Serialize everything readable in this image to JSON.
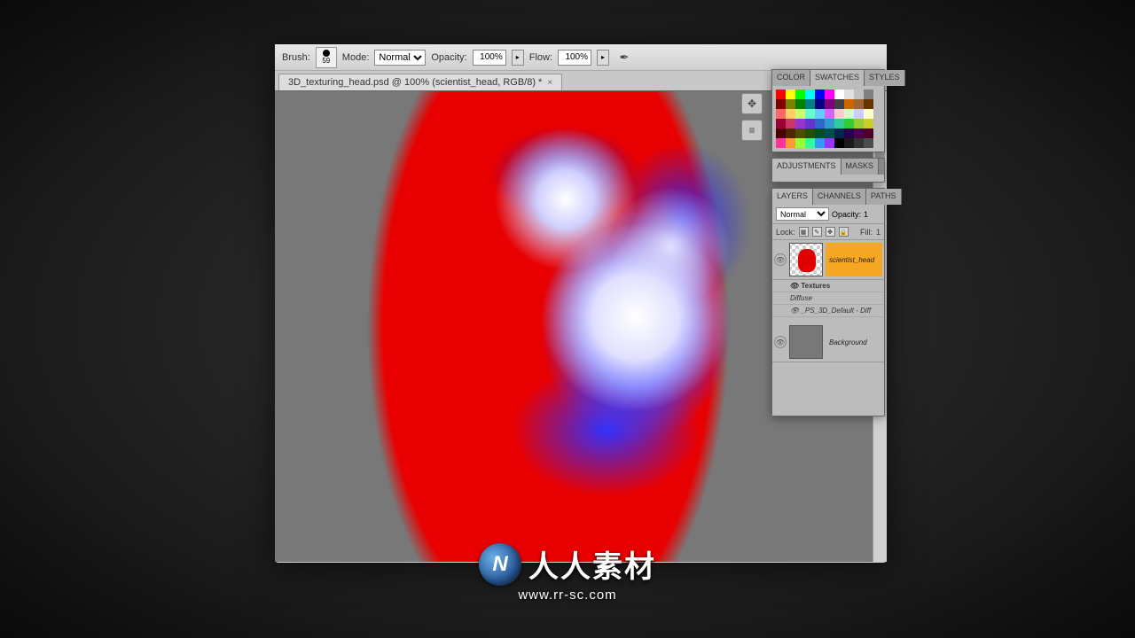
{
  "toolbar": {
    "brush_label": "Brush:",
    "brush_size": "59",
    "mode_label": "Mode:",
    "mode_value": "Normal",
    "opacity_label": "Opacity:",
    "opacity_value": "100%",
    "flow_label": "Flow:",
    "flow_value": "100%"
  },
  "document": {
    "tab_title": "3D_texturing_head.psd @ 100% (scientist_head, RGB/8) *"
  },
  "panels": {
    "color_tab": "COLOR",
    "swatches_tab": "SWATCHES",
    "styles_tab": "STYLES",
    "adjustments_tab": "ADJUSTMENTS",
    "masks_tab": "MASKS",
    "layers_tab": "LAYERS",
    "channels_tab": "CHANNELS",
    "paths_tab": "PATHS"
  },
  "layers": {
    "blend_mode": "Normal",
    "opacity_label": "Opacity:",
    "opacity_value": "1",
    "lock_label": "Lock:",
    "fill_label": "Fill:",
    "fill_value": "1",
    "layer1_name": "scientist_head",
    "textures_label": "Textures",
    "diffuse_label": "Diffuse",
    "diffuse_item": "_PS_3D_Default - Diff",
    "bg_name": "Background"
  },
  "swatches": {
    "rows": [
      [
        "#ff0000",
        "#ffff00",
        "#00ff00",
        "#00ffff",
        "#0000ff",
        "#ff00ff",
        "#ffffff",
        "#e0e0e0",
        "#c0c0c0",
        "#808080"
      ],
      [
        "#800000",
        "#808000",
        "#008000",
        "#008080",
        "#000080",
        "#800080",
        "#404040",
        "#cc6600",
        "#996633",
        "#663300"
      ],
      [
        "#ff6666",
        "#ffcc66",
        "#ccff66",
        "#66ffcc",
        "#66ccff",
        "#cc66ff",
        "#ffcccc",
        "#ccffcc",
        "#ccccff",
        "#ffffcc"
      ],
      [
        "#990033",
        "#cc3366",
        "#9933cc",
        "#6633cc",
        "#3366cc",
        "#3399cc",
        "#33cc99",
        "#33cc33",
        "#99cc33",
        "#cccc33"
      ],
      [
        "#4d0000",
        "#4d2600",
        "#4d4d00",
        "#264d00",
        "#004d26",
        "#004d4d",
        "#00264d",
        "#26004d",
        "#4d004d",
        "#4d0026"
      ],
      [
        "#ff3399",
        "#ff9933",
        "#99ff33",
        "#33ff99",
        "#3399ff",
        "#9933ff",
        "#000000",
        "#1a1a1a",
        "#333333",
        "#4d4d4d"
      ]
    ]
  },
  "watermark": {
    "badge": "N",
    "text": "人人素材",
    "url": "www.rr-sc.com"
  }
}
